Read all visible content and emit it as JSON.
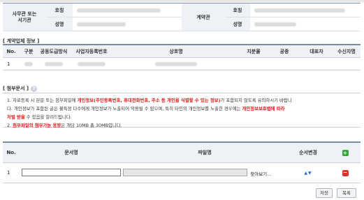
{
  "info_table": {
    "left_label": "사무관 또는\n서기관",
    "title_label": "호칭",
    "name_label": "성명",
    "right_label": "계약관",
    "right_title_label": "호칭",
    "right_name_label": "성명"
  },
  "contractor": {
    "section_title": "[ 계약업체 정보 ]",
    "columns": [
      "No.",
      "구분",
      "공동도급방식",
      "사업자등록번호",
      "상호명",
      "지분율",
      "공종",
      "대표자",
      "수신자명"
    ],
    "row_no": "1"
  },
  "attachments": {
    "section_title": "[ 첨부문서 ]",
    "notice": {
      "l1_a": "1.  자료등록 시 본문 또는 첨부파일에 ",
      "l1_red": "개인정보(주민등록번호, 휴대전화번호, 주소 등 개인을 식별할 수 있는 정보)",
      "l1_b": "가 포함되지 않도록 유의하시기 바랍니",
      "l2_a": "    다. 개인정보가 포함된 글은 불특정 다수에게 개인정보가 노출되어 악용될 수 있으며, 특히 타인의 개인정보를 노출한 경우에는 ",
      "l2_red": "개인정보보호법에 따라",
      "l3_red": "    처벌 받을",
      "l3_b": " 수 있음을 알려드립니다.",
      "l4_a": "2.  ",
      "l4_red": "첨부파일의 첨부가능 용량",
      "l4_b": "은 개당 10MB 총 30MB입니다."
    },
    "columns": {
      "no": "No.",
      "doc_name": "문서명",
      "file_name": "파일명",
      "order": "순서변경"
    },
    "row": {
      "no": "1",
      "doc_value": "",
      "browse": "찾아보기..."
    }
  },
  "buttons": {
    "save": "저장",
    "list": "목록"
  },
  "icons": {
    "help": "help-icon",
    "add": "add-row-icon",
    "remove": "remove-row-icon",
    "order": "order-arrows-icon"
  },
  "colors": {
    "accent_red": "#e01a1a",
    "add_green": "#37a63a",
    "remove_red": "#d9342b",
    "header_bg": "#eef1f5"
  }
}
